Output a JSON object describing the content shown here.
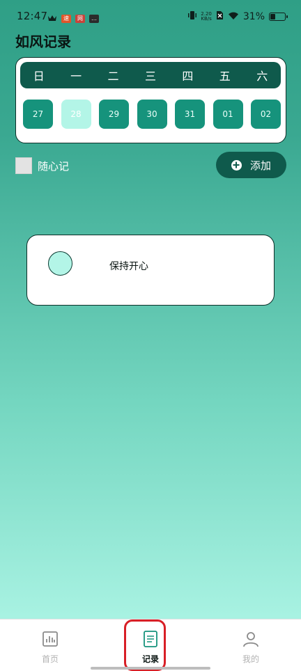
{
  "status_bar": {
    "time": "12:47",
    "net_speed_value": "2.20",
    "net_speed_unit": "KB/s",
    "battery": "31%",
    "icons": [
      "crown-icon",
      "app-badge-icon",
      "app-badge-icon",
      "app-badge-icon",
      "vibrate-icon",
      "no-sim-icon",
      "wifi-icon",
      "battery-icon"
    ]
  },
  "app": {
    "title": "如风记录"
  },
  "calendar": {
    "weekdays": [
      "日",
      "一",
      "二",
      "三",
      "四",
      "五",
      "六"
    ],
    "dates": [
      "27",
      "28",
      "29",
      "30",
      "31",
      "01",
      "02"
    ],
    "selected_index": 1
  },
  "free_note": {
    "label": "随心记",
    "checked": false
  },
  "add_button": {
    "label": "添加",
    "icon": "plus-circle-icon"
  },
  "records": [
    {
      "text": "保持开心",
      "dot_color": "#b3f5e7"
    }
  ],
  "bottom_nav": {
    "items": [
      {
        "label": "首页",
        "icon": "bar-chart-icon",
        "active": false
      },
      {
        "label": "记录",
        "icon": "document-icon",
        "active": true
      },
      {
        "label": "我的",
        "icon": "user-icon",
        "active": false
      }
    ]
  },
  "colors": {
    "primary_dark": "#0f5a4c",
    "date_chip": "#16937c",
    "date_selected": "#b3f5e7",
    "highlight": "#d81f26"
  }
}
